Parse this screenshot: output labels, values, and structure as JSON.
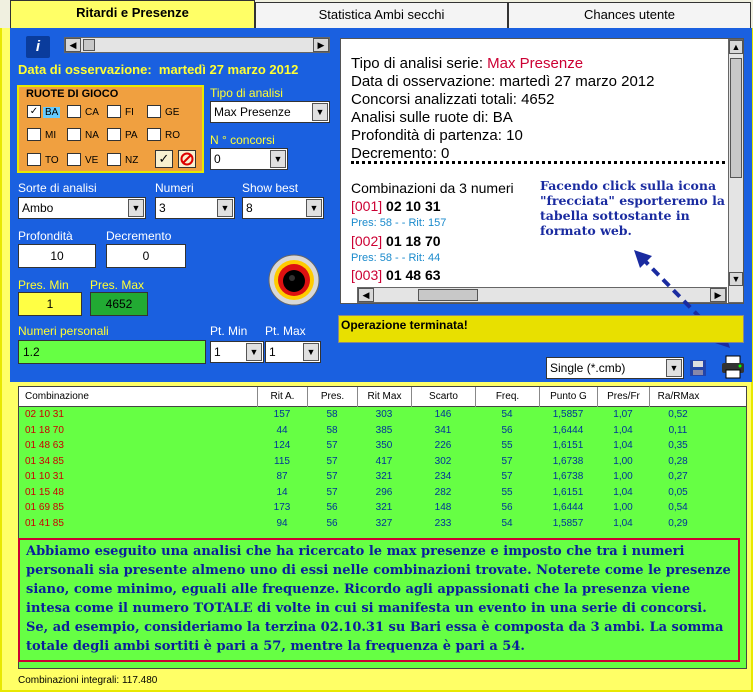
{
  "tabs": [
    {
      "label": "Ritardi e Presenze",
      "active": true
    },
    {
      "label": "Statistica Ambi secchi",
      "active": false
    },
    {
      "label": "Chances utente",
      "active": false
    }
  ],
  "observation": {
    "label": "Data di osservazione:",
    "value": "martedì 27 marzo 2012"
  },
  "ruote": {
    "title": "RUOTE DI GIOCO",
    "items": [
      {
        "label": "BA",
        "checked": true
      },
      {
        "label": "CA",
        "checked": false
      },
      {
        "label": "FI",
        "checked": false
      },
      {
        "label": "GE",
        "checked": false
      },
      {
        "label": "MI",
        "checked": false
      },
      {
        "label": "NA",
        "checked": false
      },
      {
        "label": "PA",
        "checked": false
      },
      {
        "label": "RO",
        "checked": false
      },
      {
        "label": "TO",
        "checked": false
      },
      {
        "label": "VE",
        "checked": false
      },
      {
        "label": "NZ",
        "checked": false
      }
    ]
  },
  "tipo_analisi": {
    "label": "Tipo di analisi",
    "value": "Max Presenze"
  },
  "n_concorsi": {
    "label": "N ° concorsi",
    "value": "0"
  },
  "sorte": {
    "label": "Sorte di analisi",
    "value": "Ambo"
  },
  "numeri": {
    "label": "Numeri",
    "value": "3"
  },
  "show_best": {
    "label": "Show best",
    "value": "8"
  },
  "profondita": {
    "label": "Profondità",
    "value": "10"
  },
  "decremento": {
    "label": "Decremento",
    "value": "0"
  },
  "pres_min": {
    "label": "Pres. Min",
    "value": "1"
  },
  "pres_max": {
    "label": "Pres. Max",
    "value": "4652"
  },
  "numeri_personali": {
    "label": "Numeri personali",
    "value": "1.2"
  },
  "pt_min": {
    "label": "Pt. Min",
    "value": "1"
  },
  "pt_max": {
    "label": "Pt. Max",
    "value": "1"
  },
  "info": {
    "tipo_label": "Tipo di analisi serie: ",
    "tipo_value": "Max Presenze",
    "data": "Data di osservazione: martedì 27 marzo 2012",
    "concorsi": "Concorsi analizzati totali: 4652",
    "ruote": "Analisi sulle ruote di: BA",
    "profondita": "Profondità di partenza: 10",
    "decremento": "Decremento: 0",
    "comb_title": "Combinazioni da 3 numeri",
    "entries": [
      {
        "id": "[001]",
        "nums": "02 10 31",
        "stat": "Pres: 58 - - Rit: 157"
      },
      {
        "id": "[002]",
        "nums": "01 18 70",
        "stat": "Pres: 58 - - Rit: 44"
      },
      {
        "id": "[003]",
        "nums": "01 48 63",
        "stat": ""
      }
    ]
  },
  "callout": "Facendo click sulla icona \"frecciata\" esporteremo la tabella sottostante in formato web.",
  "status": "Operazione terminata!",
  "format": {
    "value": "Single (*.cmb)"
  },
  "table": {
    "headers": [
      "Combinazione",
      "Rit A.",
      "Pres.",
      "Rit Max",
      "Scarto",
      "Freq.",
      "Punto G",
      "Pres/Fr",
      "Ra/RMax"
    ],
    "rows": [
      [
        "02 10 31",
        "157",
        "58",
        "303",
        "146",
        "54",
        "1,5857",
        "1,07",
        "0,52"
      ],
      [
        "01 18 70",
        "44",
        "58",
        "385",
        "341",
        "56",
        "1,6444",
        "1,04",
        "0,11"
      ],
      [
        "01 48 63",
        "124",
        "57",
        "350",
        "226",
        "55",
        "1,6151",
        "1,04",
        "0,35"
      ],
      [
        "01 34 85",
        "115",
        "57",
        "417",
        "302",
        "57",
        "1,6738",
        "1,00",
        "0,28"
      ],
      [
        "01 10 31",
        "87",
        "57",
        "321",
        "234",
        "57",
        "1,6738",
        "1,00",
        "0,27"
      ],
      [
        "01 15 48",
        "14",
        "57",
        "296",
        "282",
        "55",
        "1,6151",
        "1,04",
        "0,05"
      ],
      [
        "01 69 85",
        "173",
        "56",
        "321",
        "148",
        "56",
        "1,6444",
        "1,00",
        "0,54"
      ],
      [
        "01 41 85",
        "94",
        "56",
        "327",
        "233",
        "54",
        "1,5857",
        "1,04",
        "0,29"
      ]
    ]
  },
  "note": "Abbiamo eseguito una analisi che ha ricercato le max presenze e imposto che tra i numeri personali sia presente almeno uno di essi nelle combinazioni trovate. Noterete come le presenze siano, come minimo, eguali alle frequenze. Ricordo agli appassionati che la presenza viene intesa come il numero TOTALE di volte in cui si manifesta un evento in una serie di concorsi. Se, ad esempio, consideriamo la terzina 02.10.31 su Bari essa è composta da 3 ambi. La somma totale degli ambi sortiti è pari a 57, mentre la frequenza è pari a 54.",
  "footer": "Combinazioni integrali: 117.480"
}
